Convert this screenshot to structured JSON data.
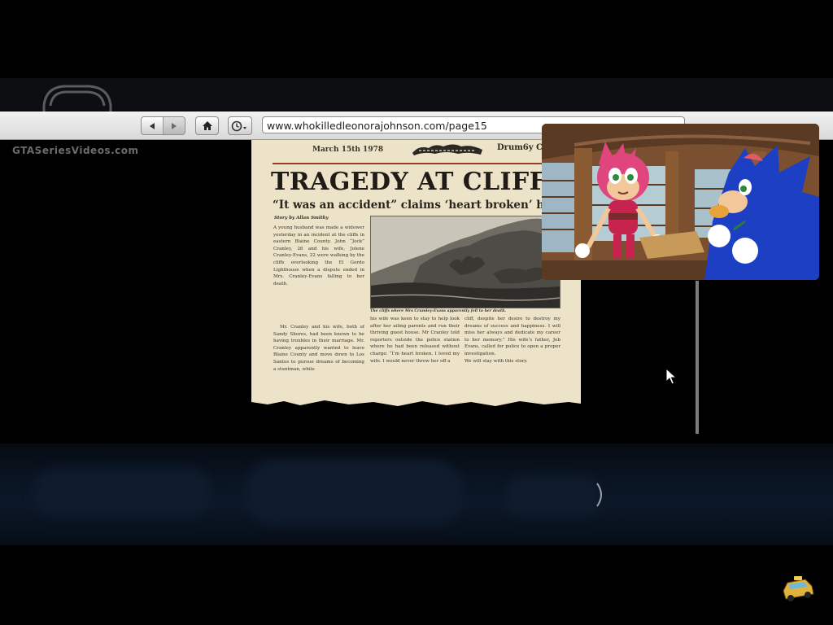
{
  "watermark": {
    "channel": "GTASeriesVideos.com",
    "logo_icon": "car-outline-logo-icon"
  },
  "browser": {
    "back_icon": "back-arrow-icon",
    "forward_icon": "forward-arrow-icon",
    "home_icon": "home-icon",
    "history_icon": "clock-history-icon",
    "url": "www.whokilledleonorajohnson.com/page15",
    "colors": {
      "toolbar": "#e6e6e6",
      "border": "#8c8c8c"
    }
  },
  "newspaper": {
    "date": "March 15th 1978",
    "masthead_suffix": "Drum6y C",
    "headline": "TRAGEDY AT CLIFF",
    "subheadline": "“It was an accident” claims ‘heart broken’ husba",
    "byline": "Story by Allan Smithy",
    "photo_caption": "The cliffs where Mrs Crumley-Evans apparently fell to her death.",
    "column1": [
      "A young husband was made a widower yesterday in an incident at the cliffs in eastern Blaine County. John “Jock” Cranley, 26 and his wife, Jolene Cranley-Evans, 22 were walking by the cliffs overlooking the El Gordo Lighthouse when a dispute ended in Mrs. Cranley-Evans falling to her death.",
      "Mr. Cranley and his wife, both of Sandy Shores, had been known to be having troubles in their marriage. Mr. Cranley apparently wanted to leave Blaine County and move down to Los Santos to pursue dreams of becoming a stuntman, while"
    ],
    "column2": "his wife was keen to stay to help look after her ailing parents and run their thriving guest house. Mr Cranley told reporters outside the police station where he had been released without charge: “I’m heart broken. I loved my wife. I would never throw her off a",
    "column3": "cliff, despite her desire to destroy my dreams of success and happiness. I will miss her always and dedicate my career to her memory.” His wife’s father, Jeb Evans, called for police to open a proper investigation.\nWe will stay with this story.",
    "colors": {
      "paper": "#ece3c8",
      "rule": "#9b3b30",
      "ink": "#1f1b16"
    }
  },
  "video_overlay": {
    "scene": "cartoon-scene",
    "colors": {
      "background": "#6a4528",
      "pink_character": "#e0457e",
      "blue_character": "#1d3fc4"
    }
  },
  "cursor_icon": "mouse-pointer-icon",
  "corner_logo_icon": "taxi-cab-logo-icon"
}
